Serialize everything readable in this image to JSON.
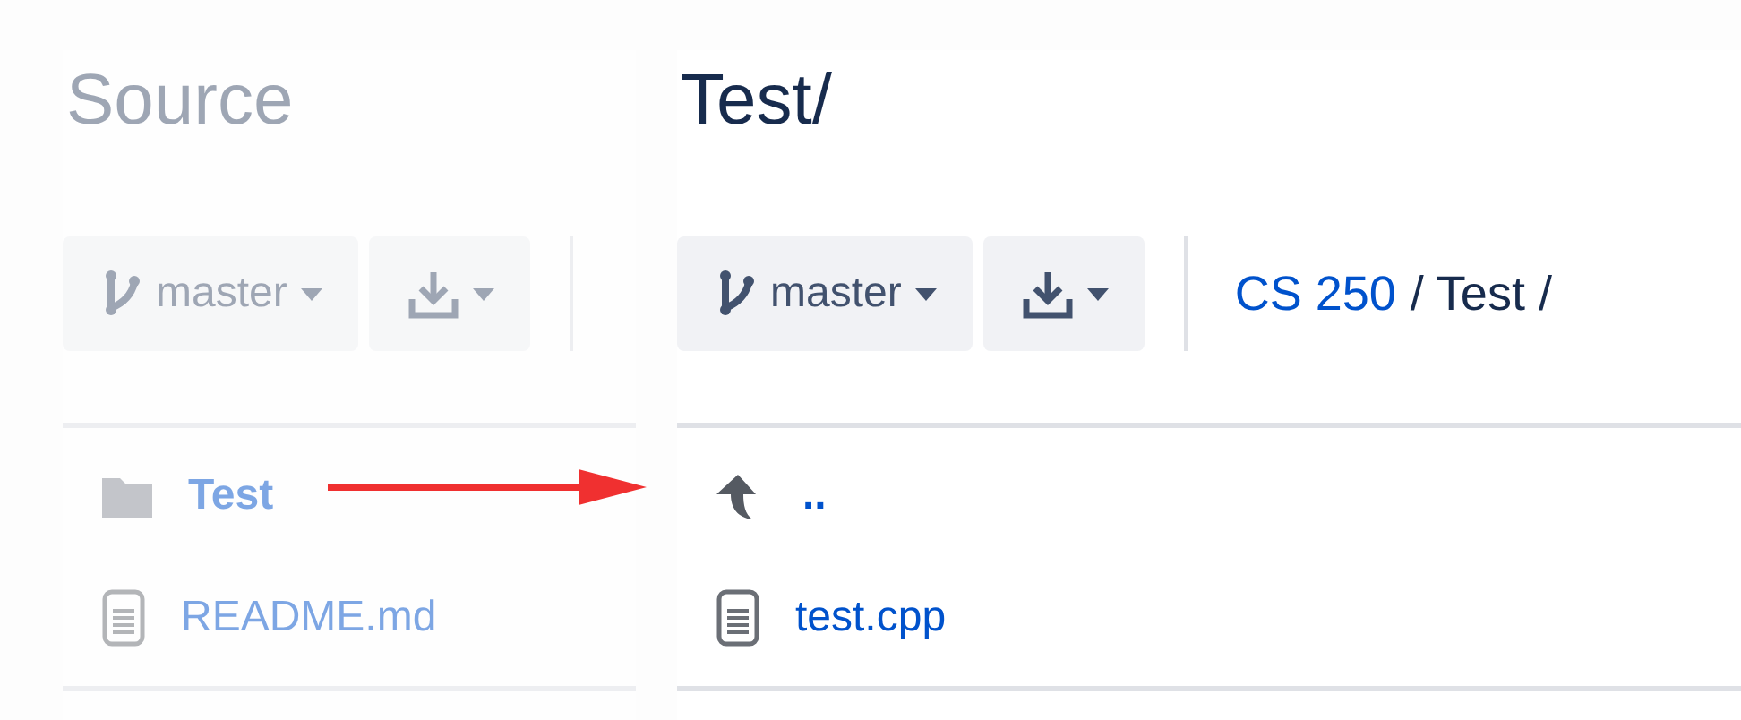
{
  "panels": [
    {
      "faded": true,
      "title": "Source",
      "branch": "master",
      "rows": [
        {
          "kind": "folder",
          "name": "Test"
        },
        {
          "kind": "file",
          "name": "README.md"
        }
      ]
    },
    {
      "faded": false,
      "title": "Test/",
      "branch": "master",
      "breadcrumb": {
        "link": "CS 250",
        "rest": "/ Test /"
      },
      "rows": [
        {
          "kind": "parent",
          "name": ".."
        },
        {
          "kind": "file",
          "name": "test.cpp"
        }
      ]
    }
  ]
}
